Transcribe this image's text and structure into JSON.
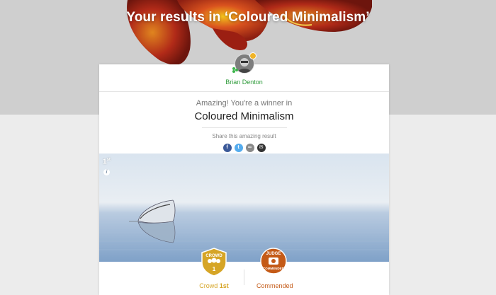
{
  "hero": {
    "title": "Your results in ‘Coloured Minimalism’"
  },
  "user": {
    "name": "Brian Denton"
  },
  "result": {
    "intro": "Amazing! You're a winner in",
    "challenge": "Coloured Minimalism",
    "share_label": "Share this amazing result",
    "share_buttons": [
      "facebook-icon",
      "twitter-icon",
      "link-icon",
      "email-icon"
    ]
  },
  "photo": {
    "rank": "1",
    "rank_suffix": "st",
    "info": "i"
  },
  "badges": {
    "crowd": {
      "top": "CROWD",
      "number": "1",
      "label_prefix": "Crowd",
      "label_value": "1st",
      "color": "#d6a526"
    },
    "judge": {
      "top": "JUDGE",
      "bottom": "COMMENDED",
      "label": "Commended",
      "color": "#c45a17"
    }
  },
  "colors": {
    "accent_green": "#2e9b3a",
    "facebook": "#3b5998",
    "twitter": "#55acee",
    "link": "#8a8a8a",
    "email": "#333333"
  }
}
